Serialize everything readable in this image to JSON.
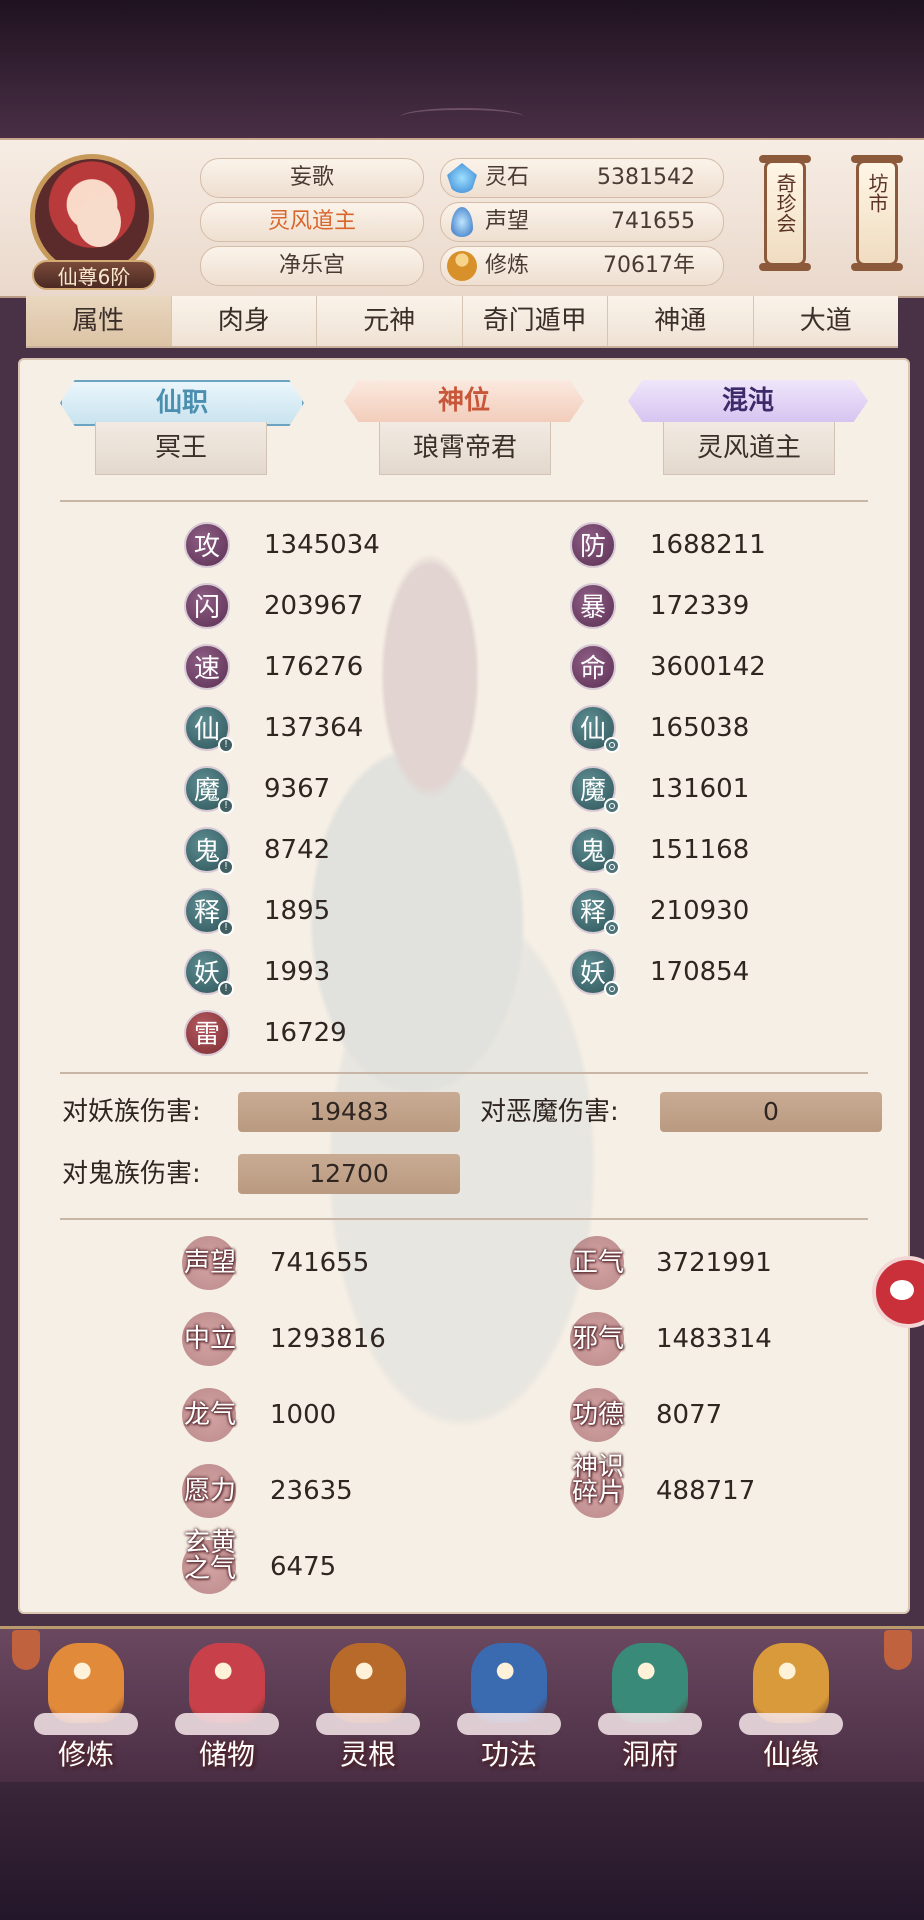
{
  "player": {
    "rank": "仙尊6阶",
    "name": "妄歌",
    "title": "灵风道主",
    "sect": "净乐宫"
  },
  "resources": [
    {
      "label": "灵石",
      "value": "5381542",
      "icon": "spirit-stone-icon",
      "color": "#3f9fe0"
    },
    {
      "label": "声望",
      "value": "741655",
      "icon": "prestige-icon",
      "color": "#4a8fd8"
    },
    {
      "label": "修炼",
      "value": "70617年",
      "icon": "meditation-icon",
      "color": "#e0a040"
    }
  ],
  "side_buttons": {
    "treasure": "奇珍会",
    "market": "坊市"
  },
  "tabs": [
    "属性",
    "肉身",
    "元神",
    "奇门遁甲",
    "神通",
    "大道"
  ],
  "active_tab": "属性",
  "positions": [
    {
      "label": "仙职",
      "value": "冥王",
      "color": "#4a8fb0"
    },
    {
      "label": "神位",
      "value": "琅霄帝君",
      "color": "#c8573a"
    },
    {
      "label": "混沌",
      "value": "灵风道主",
      "color": "#5b3a8a"
    }
  ],
  "stats_left": [
    {
      "glyph": "攻",
      "value": "1345034",
      "style": "purple"
    },
    {
      "glyph": "闪",
      "value": "203967",
      "style": "purple"
    },
    {
      "glyph": "速",
      "value": "176276",
      "style": "purple"
    },
    {
      "glyph": "仙",
      "value": "137364",
      "style": "teal"
    },
    {
      "glyph": "魔",
      "value": "9367",
      "style": "teal"
    },
    {
      "glyph": "鬼",
      "value": "8742",
      "style": "teal"
    },
    {
      "glyph": "释",
      "value": "1895",
      "style": "teal"
    },
    {
      "glyph": "妖",
      "value": "1993",
      "style": "teal"
    },
    {
      "glyph": "雷",
      "value": "16729",
      "style": "red"
    }
  ],
  "stats_right": [
    {
      "glyph": "防",
      "value": "1688211",
      "style": "purple"
    },
    {
      "glyph": "暴",
      "value": "172339",
      "style": "purple"
    },
    {
      "glyph": "命",
      "value": "3600142",
      "style": "purple"
    },
    {
      "glyph": "仙",
      "value": "165038",
      "style": "teal"
    },
    {
      "glyph": "魔",
      "value": "131601",
      "style": "teal"
    },
    {
      "glyph": "鬼",
      "value": "151168",
      "style": "teal"
    },
    {
      "glyph": "释",
      "value": "210930",
      "style": "teal"
    },
    {
      "glyph": "妖",
      "value": "170854",
      "style": "teal"
    }
  ],
  "damage": [
    {
      "label": "对妖族伤害:",
      "value": "19483"
    },
    {
      "label": "对恶魔伤害:",
      "value": "0"
    },
    {
      "label": "对鬼族伤害:",
      "value": "12700"
    }
  ],
  "reputation_left": [
    {
      "label": "声望",
      "value": "741655"
    },
    {
      "label": "中立",
      "value": "1293816"
    },
    {
      "label": "龙气",
      "value": "1000"
    },
    {
      "label": "愿力",
      "value": "23635"
    },
    {
      "label": "玄黄之气",
      "value": "6475"
    }
  ],
  "reputation_right": [
    {
      "label": "正气",
      "value": "3721991"
    },
    {
      "label": "邪气",
      "value": "1483314"
    },
    {
      "label": "功德",
      "value": "8077"
    },
    {
      "label": "神识碎片",
      "value": "488717"
    }
  ],
  "bottom_nav": [
    {
      "label": "修炼",
      "icon": "cultivate-icon",
      "color": "#e08a3a"
    },
    {
      "label": "储物",
      "icon": "storage-bag-icon",
      "color": "#c8404a"
    },
    {
      "label": "灵根",
      "icon": "spirit-root-icon",
      "color": "#b86a2a"
    },
    {
      "label": "功法",
      "icon": "technique-book-icon",
      "color": "#3a6ab0"
    },
    {
      "label": "洞府",
      "icon": "cave-dwelling-icon",
      "color": "#3a8a7a"
    },
    {
      "label": "仙缘",
      "icon": "gourd-icon",
      "color": "#d89a3a"
    }
  ]
}
